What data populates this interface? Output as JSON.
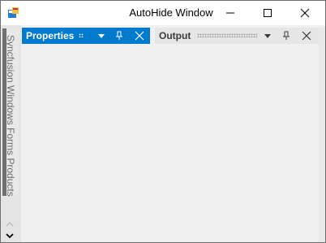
{
  "window": {
    "title": "AutoHide Window"
  },
  "caption_buttons": {
    "minimize_icon": "minimize-icon",
    "maximize_icon": "maximize-icon",
    "close_icon": "close-icon"
  },
  "autohide_tab": {
    "label": "Syncfusion Windows Forms Products"
  },
  "panels": [
    {
      "title": "Properties",
      "active": true,
      "header_color": "#007acc",
      "buttons": [
        "dropdown-icon",
        "pin-icon",
        "close-icon"
      ]
    },
    {
      "title": "Output",
      "active": false,
      "header_color": "#e6e6e6",
      "buttons": [
        "dropdown-icon",
        "pin-icon",
        "close-icon"
      ]
    }
  ]
}
